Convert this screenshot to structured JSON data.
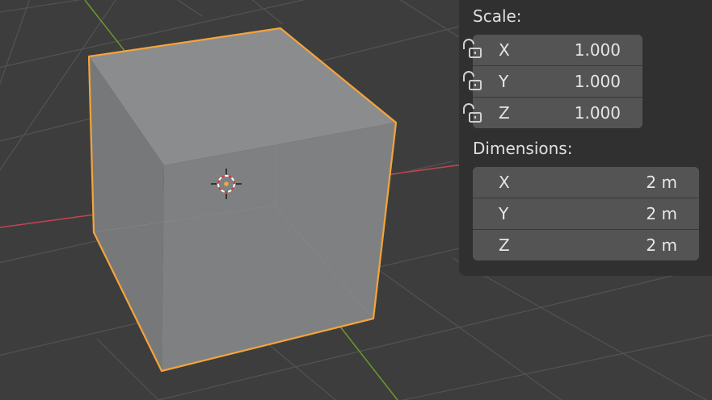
{
  "transform_panel": {
    "scale_label": "Scale:",
    "scale": [
      {
        "axis": "X",
        "value": "1.000"
      },
      {
        "axis": "Y",
        "value": "1.000"
      },
      {
        "axis": "Z",
        "value": "1.000"
      }
    ],
    "dimensions_label": "Dimensions:",
    "dimensions": [
      {
        "axis": "X",
        "value": "2 m"
      },
      {
        "axis": "Y",
        "value": "2 m"
      },
      {
        "axis": "Z",
        "value": "2 m"
      }
    ]
  },
  "colors": {
    "viewport_bg": "#3d3d3d",
    "grid": "#535353",
    "x_axis": "#c14450",
    "y_axis": "#6b9a2c",
    "selection_outline": "#f5a43a",
    "panel_bg": "#303030",
    "field_bg": "#545454"
  },
  "icons": {
    "lock": "unlocked-padlock-icon",
    "origin": "3d-cursor-icon"
  }
}
